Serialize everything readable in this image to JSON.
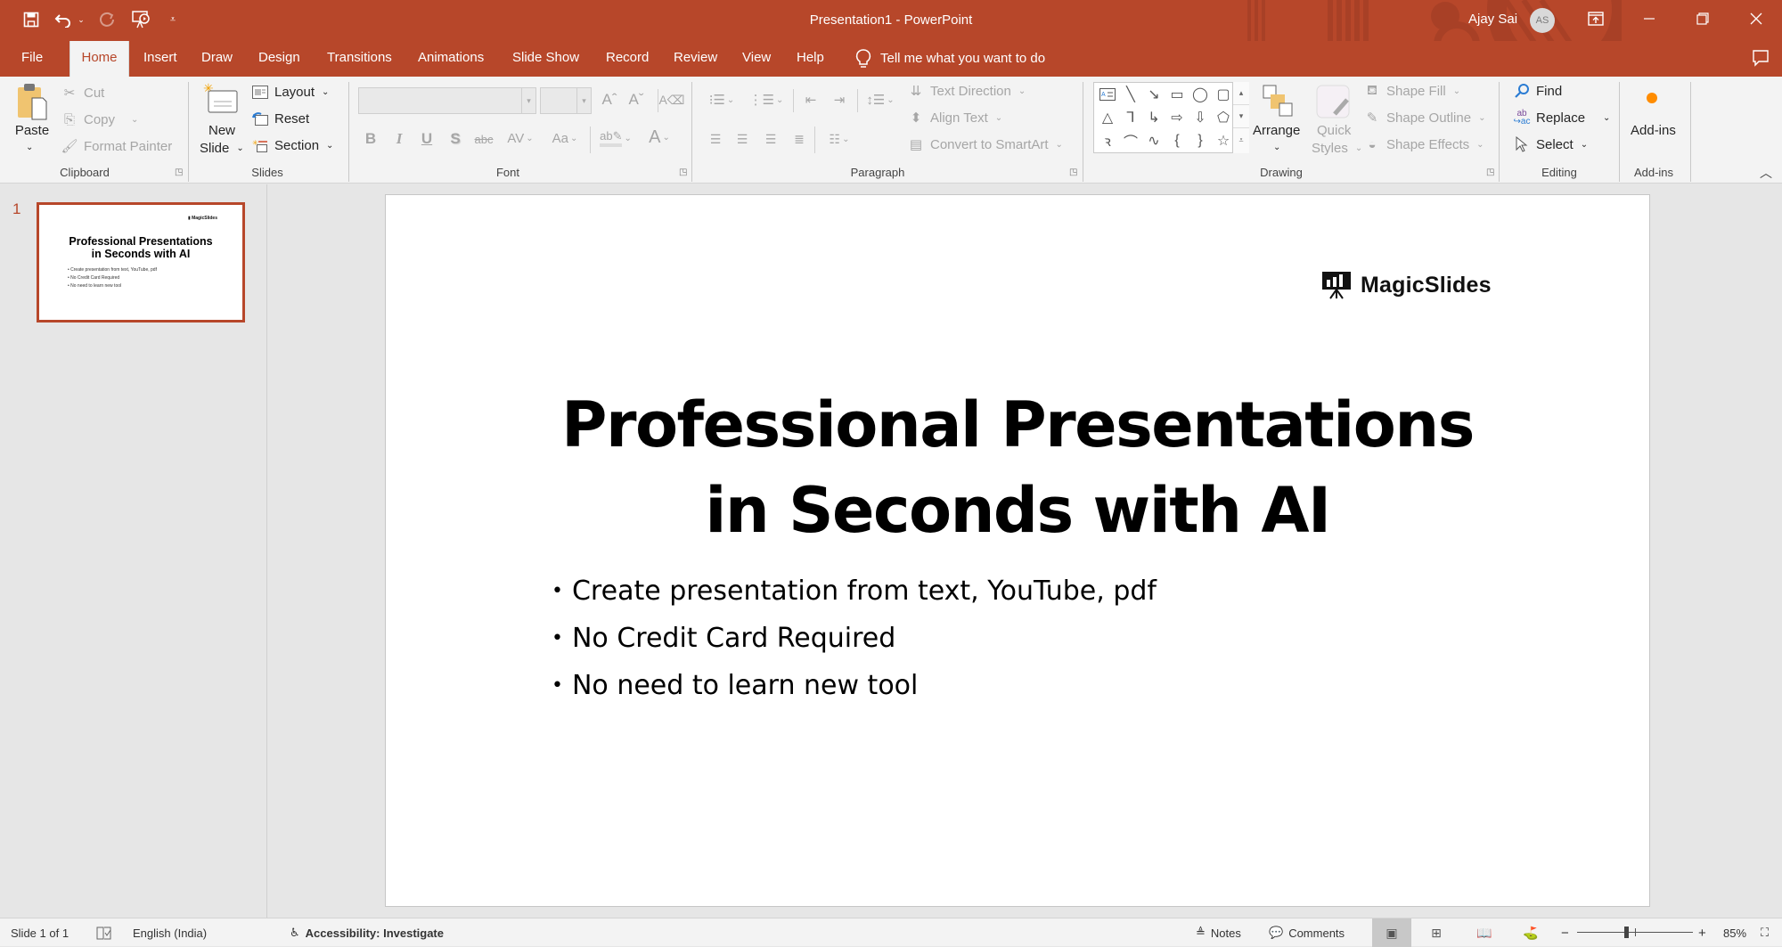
{
  "window": {
    "title": "Presentation1  -  PowerPoint",
    "user_name": "Ajay Sai",
    "user_initials": "AS",
    "accent_color": "#b7472a"
  },
  "qat": {
    "save": "save-icon",
    "undo": "undo-icon",
    "redo": "redo-icon",
    "present": "present-from-beginning-icon",
    "customize": "customize-qat-icon"
  },
  "tabs": [
    {
      "label": "File"
    },
    {
      "label": "Home",
      "active": true
    },
    {
      "label": "Insert"
    },
    {
      "label": "Draw"
    },
    {
      "label": "Design"
    },
    {
      "label": "Transitions"
    },
    {
      "label": "Animations"
    },
    {
      "label": "Slide Show"
    },
    {
      "label": "Record"
    },
    {
      "label": "Review"
    },
    {
      "label": "View"
    },
    {
      "label": "Help"
    }
  ],
  "tell_me": "Tell me what you want to do",
  "ribbon": {
    "clipboard": {
      "label": "Clipboard",
      "paste": "Paste",
      "cut": "Cut",
      "copy": "Copy",
      "format_painter": "Format Painter"
    },
    "slides": {
      "label": "Slides",
      "new_slide_1": "New",
      "new_slide_2": "Slide",
      "layout": "Layout",
      "reset": "Reset",
      "section": "Section"
    },
    "font": {
      "label": "Font",
      "font_name": "",
      "font_size": ""
    },
    "paragraph": {
      "label": "Paragraph",
      "text_direction": "Text Direction",
      "align_text": "Align Text",
      "convert_smartart": "Convert to SmartArt"
    },
    "drawing": {
      "label": "Drawing",
      "arrange": "Arrange",
      "quick_styles_1": "Quick",
      "quick_styles_2": "Styles",
      "shape_fill": "Shape Fill",
      "shape_outline": "Shape Outline",
      "shape_effects": "Shape Effects"
    },
    "editing": {
      "label": "Editing",
      "find": "Find",
      "replace": "Replace",
      "select": "Select"
    },
    "addins": {
      "label": "Add-ins",
      "button": "Add-ins"
    }
  },
  "thumbnails": [
    {
      "number": "1"
    }
  ],
  "slide": {
    "logo_text": "MagicSlides",
    "title_line1": "Professional Presentations",
    "title_line2": "in Seconds with AI",
    "bullets": [
      "Create presentation from text, YouTube, pdf",
      "No Credit Card Required",
      "No need to learn new tool"
    ]
  },
  "statusbar": {
    "slide_info": "Slide 1 of 1",
    "language": "English (India)",
    "accessibility": "Accessibility: Investigate",
    "notes": "Notes",
    "comments": "Comments",
    "zoom_minus": "−",
    "zoom_plus": "+",
    "zoom_level": "85%",
    "zoom_percent": 85
  }
}
